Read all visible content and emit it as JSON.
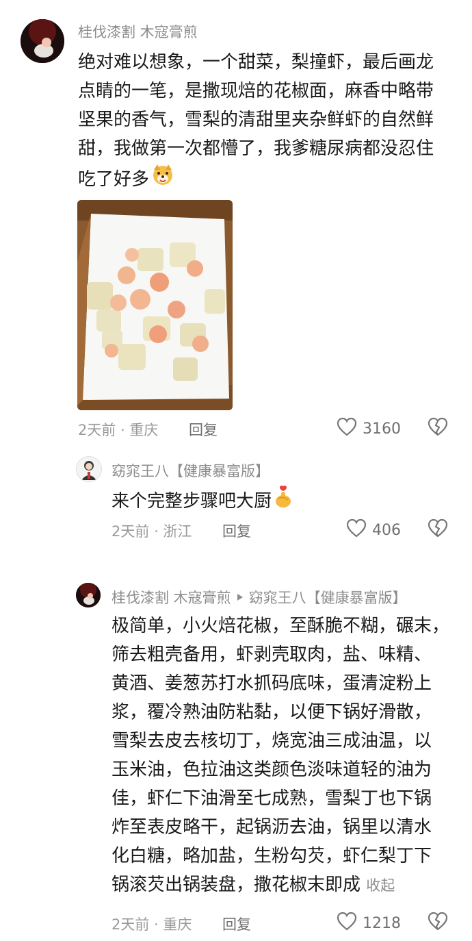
{
  "comment1": {
    "username": "桂伐漆割 木寇膏煎",
    "lines": [
      "绝对难以想象，一个甜菜，梨撞虾，最后画龙",
      "点睛的一笔，是撒现焙的花椒面，麻香中略带",
      "坚果的香气，雪梨的清甜里夹杂鲜虾的自然鲜",
      "甜，我做第一次都懵了，我爹糖尿病都没忍住",
      "吃了好多"
    ],
    "time": "2天前",
    "location": "重庆",
    "reply_label": "回复",
    "like_count": "3160",
    "emoji_icon": "dog-face-icon",
    "image_desc": "food-photo"
  },
  "comment2": {
    "username": "窈窕王八【健康暴富版】",
    "text": "来个完整步骤吧大厨",
    "time": "2天前",
    "location": "浙江",
    "reply_label": "回复",
    "like_count": "406",
    "emoji_icon": "finger-heart-icon"
  },
  "comment3": {
    "username": "桂伐漆割 木寇膏煎",
    "reply_to": "窈窕王八【健康暴富版】",
    "lines": [
      "极简单，小火焙花椒，至酥脆不糊，碾末，",
      "筛去粗壳备用，虾剥壳取肉，盐、味精、",
      "黄酒、姜葱苏打水抓码底味，蛋清淀粉上",
      "浆，覆冷熟油防粘黏，以便下锅好滑散，",
      "雪梨去皮去核切丁，烧宽油三成油温，以",
      "玉米油，色拉油这类颜色淡味道轻的油为",
      "佳，虾仁下油滑至七成熟，雪梨丁也下锅",
      "炸至表皮略干，起锅沥去油，锅里以清水",
      "化白糖，略加盐，生粉勾芡，虾仁梨丁下",
      "锅滚芡出锅装盘，撒花椒末即成"
    ],
    "collapse_label": "收起",
    "time": "2天前",
    "location": "重庆",
    "reply_label": "回复",
    "like_count": "1218"
  },
  "colors": {
    "background": "#ffffff",
    "text": "#1a1a1a",
    "muted": "#8c8c8c"
  }
}
